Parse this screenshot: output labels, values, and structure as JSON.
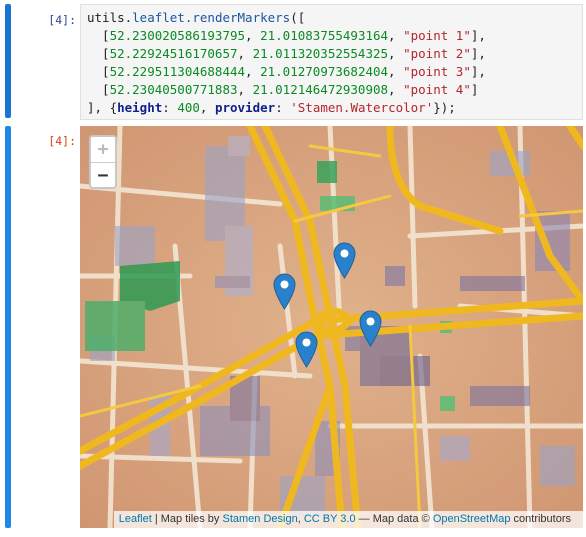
{
  "cells": [
    {
      "prompt_in": "[4]:",
      "code": {
        "line1": {
          "prefix": "utils.",
          "fn": "leaflet.renderMarkers",
          "suffix": "(["
        },
        "markers": [
          {
            "lat": "52.230020586193795",
            "lng": "21.01083755493164",
            "label": "\"point 1\""
          },
          {
            "lat": "52.22924516170657",
            "lng": "21.011320352554325",
            "label": "\"point 2\""
          },
          {
            "lat": "52.229511304688444",
            "lng": "21.01270973682404",
            "label": "\"point 3\""
          },
          {
            "lat": "52.23040500771883",
            "lng": "21.012146472930908",
            "label": "\"point 4\""
          }
        ],
        "options": {
          "open": "], {",
          "height_key": "height",
          "height_value": "400",
          "provider_key": "provider",
          "provider_value": "'Stamen.Watercolor'",
          "close": "});"
        }
      }
    },
    {
      "prompt_out": "[4]:",
      "map": {
        "zoom_in_label": "+",
        "zoom_out_label": "−",
        "attribution": {
          "leaflet": "Leaflet",
          "sep": " | Map tiles by ",
          "stamen": "Stamen Design",
          "comma": ", ",
          "license": "CC BY 3.0",
          "mid": " — Map data © ",
          "osm": "OpenStreetMap",
          "end": " contributors"
        },
        "markers_shown": 4
      }
    }
  ],
  "colors": {
    "active_cell_bar": "#1976d2",
    "prompt_in": "#303f9f",
    "prompt_out": "#d84315",
    "marker": "#2a81cb",
    "road": "#f0b81f"
  }
}
